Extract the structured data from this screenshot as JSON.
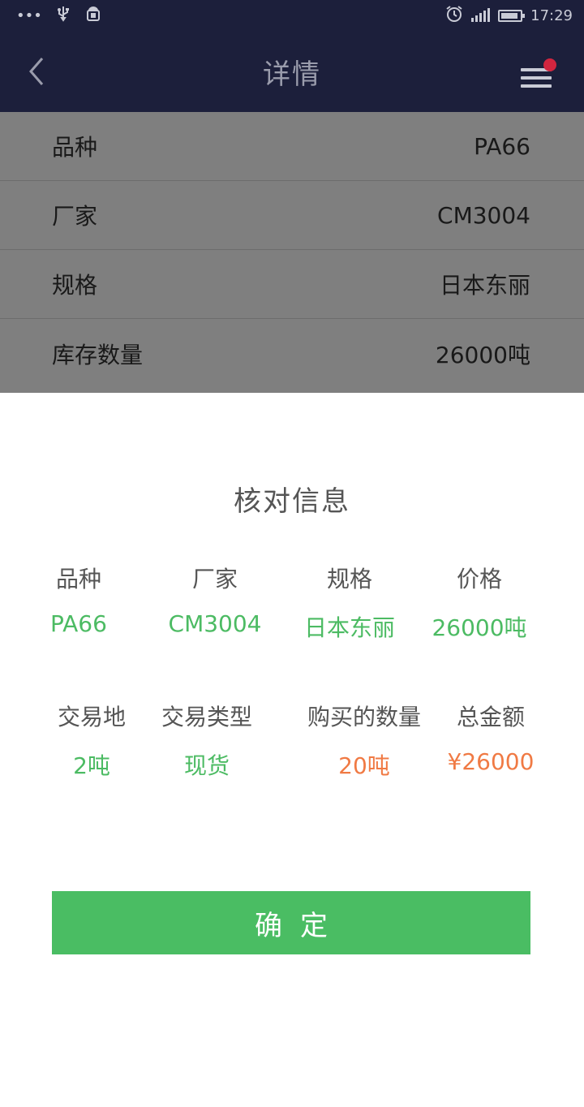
{
  "status_bar": {
    "left_icons": [
      "more-dots-icon",
      "usb-icon",
      "android-debug-icon"
    ],
    "time": "17:29",
    "colors": {
      "bg": "#1c1f3b"
    }
  },
  "header": {
    "title": "详情",
    "colors": {
      "bg": "#1c1f3b",
      "notification_dot": "#d2253f"
    }
  },
  "details": {
    "rows": [
      {
        "label": "品种",
        "value": "PA66"
      },
      {
        "label": "厂家",
        "value": "CM3004"
      },
      {
        "label": "规格",
        "value": "日本东丽"
      },
      {
        "label": "库存数量",
        "value": "26000吨"
      }
    ]
  },
  "dialog": {
    "title": "核对信息",
    "row1": [
      {
        "label": "品种",
        "value": "PA66"
      },
      {
        "label": "厂家",
        "value": "CM3004"
      },
      {
        "label": "规格",
        "value": "日本东丽"
      },
      {
        "label": "价格",
        "value": "26000吨"
      }
    ],
    "row2": [
      {
        "label": "交易地",
        "value": "2吨"
      },
      {
        "label": "交易类型",
        "value": "现货"
      },
      {
        "label": "购买的数量",
        "value": "20吨"
      },
      {
        "label": "总金额",
        "value": "¥26000"
      }
    ],
    "confirm_label": "确定",
    "colors": {
      "value_green": "#4cbb63",
      "value_orange": "#f07a44",
      "button": "#4abd63"
    }
  }
}
